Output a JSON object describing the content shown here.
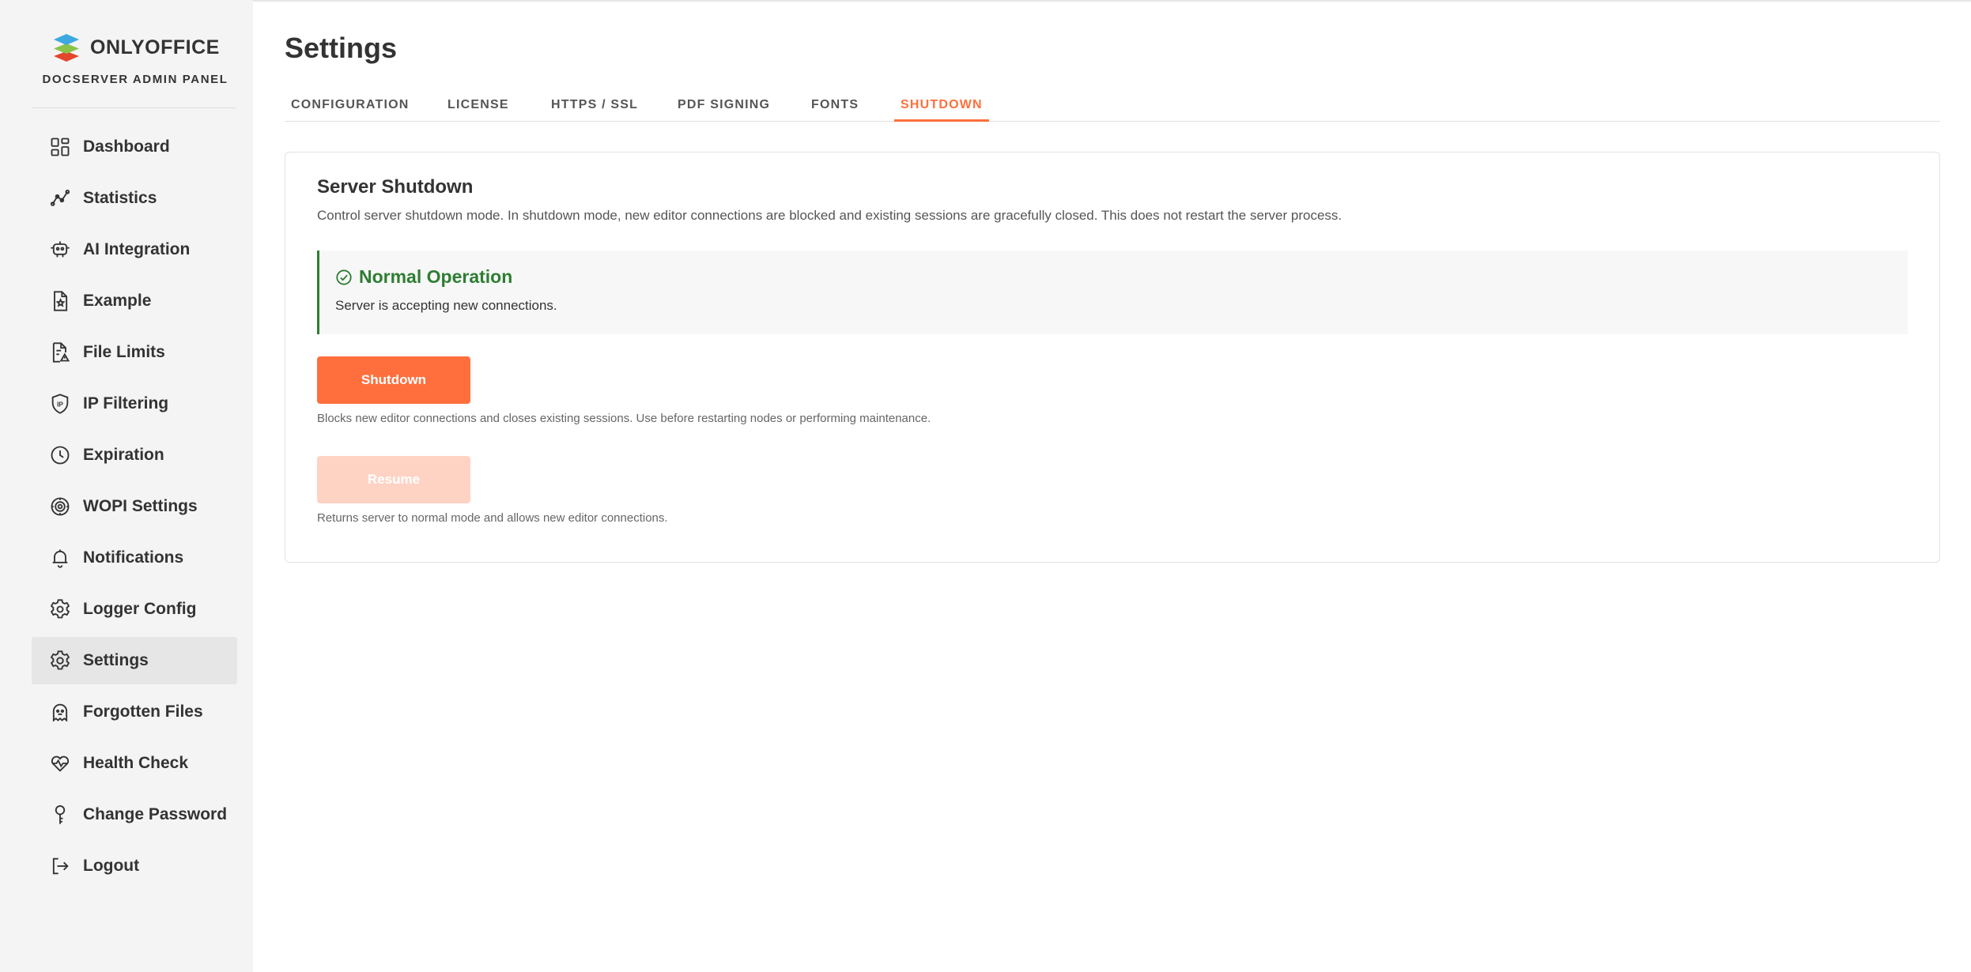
{
  "app": {
    "brand": "ONLYOFFICE",
    "panel_label": "DOCSERVER ADMIN PANEL"
  },
  "sidebar": {
    "items": [
      {
        "label": "Dashboard",
        "icon": "dashboard-icon",
        "active": false
      },
      {
        "label": "Statistics",
        "icon": "statistics-icon",
        "active": false
      },
      {
        "label": "AI Integration",
        "icon": "ai-integration-icon",
        "active": false
      },
      {
        "label": "Example",
        "icon": "example-document-icon",
        "active": false
      },
      {
        "label": "File Limits",
        "icon": "file-limits-icon",
        "active": false
      },
      {
        "label": "IP Filtering",
        "icon": "ip-filtering-shield-icon",
        "active": false
      },
      {
        "label": "Expiration",
        "icon": "clock-icon",
        "active": false
      },
      {
        "label": "WOPI Settings",
        "icon": "wopi-settings-icon",
        "active": false
      },
      {
        "label": "Notifications",
        "icon": "bell-icon",
        "active": false
      },
      {
        "label": "Logger Config",
        "icon": "logger-config-icon",
        "active": false
      },
      {
        "label": "Settings",
        "icon": "gear-icon",
        "active": true
      },
      {
        "label": "Forgotten Files",
        "icon": "ghost-icon",
        "active": false
      },
      {
        "label": "Health Check",
        "icon": "heart-pulse-icon",
        "active": false
      },
      {
        "label": "Change Password",
        "icon": "key-icon",
        "active": false
      },
      {
        "label": "Logout",
        "icon": "logout-icon",
        "active": false
      }
    ]
  },
  "main": {
    "title": "Settings",
    "tabs": [
      {
        "label": "CONFIGURATION",
        "active": false
      },
      {
        "label": "LICENSE",
        "active": false
      },
      {
        "label": "HTTPS / SSL",
        "active": false
      },
      {
        "label": "PDF SIGNING",
        "active": false
      },
      {
        "label": "FONTS",
        "active": false
      },
      {
        "label": "SHUTDOWN",
        "active": true
      }
    ],
    "card": {
      "title": "Server Shutdown",
      "description": "Control server shutdown mode. In shutdown mode, new editor connections are blocked and existing sessions are gracefully closed. This does not restart the server process.",
      "status": {
        "icon": "check-circle-icon",
        "title": "Normal Operation",
        "text": "Server is accepting new connections."
      },
      "shutdown": {
        "label": "Shutdown",
        "help": "Blocks new editor connections and closes existing sessions. Use before restarting nodes or performing maintenance."
      },
      "resume": {
        "label": "Resume",
        "disabled": true,
        "help": "Returns server to normal mode and allows new editor connections."
      }
    }
  },
  "colors": {
    "accent": "#ff6f3d",
    "accent_disabled": "#ffd3c4",
    "success": "#2e7d32",
    "sidebar_bg": "#f4f4f4",
    "sidebar_active_bg": "#e6e6e6"
  }
}
